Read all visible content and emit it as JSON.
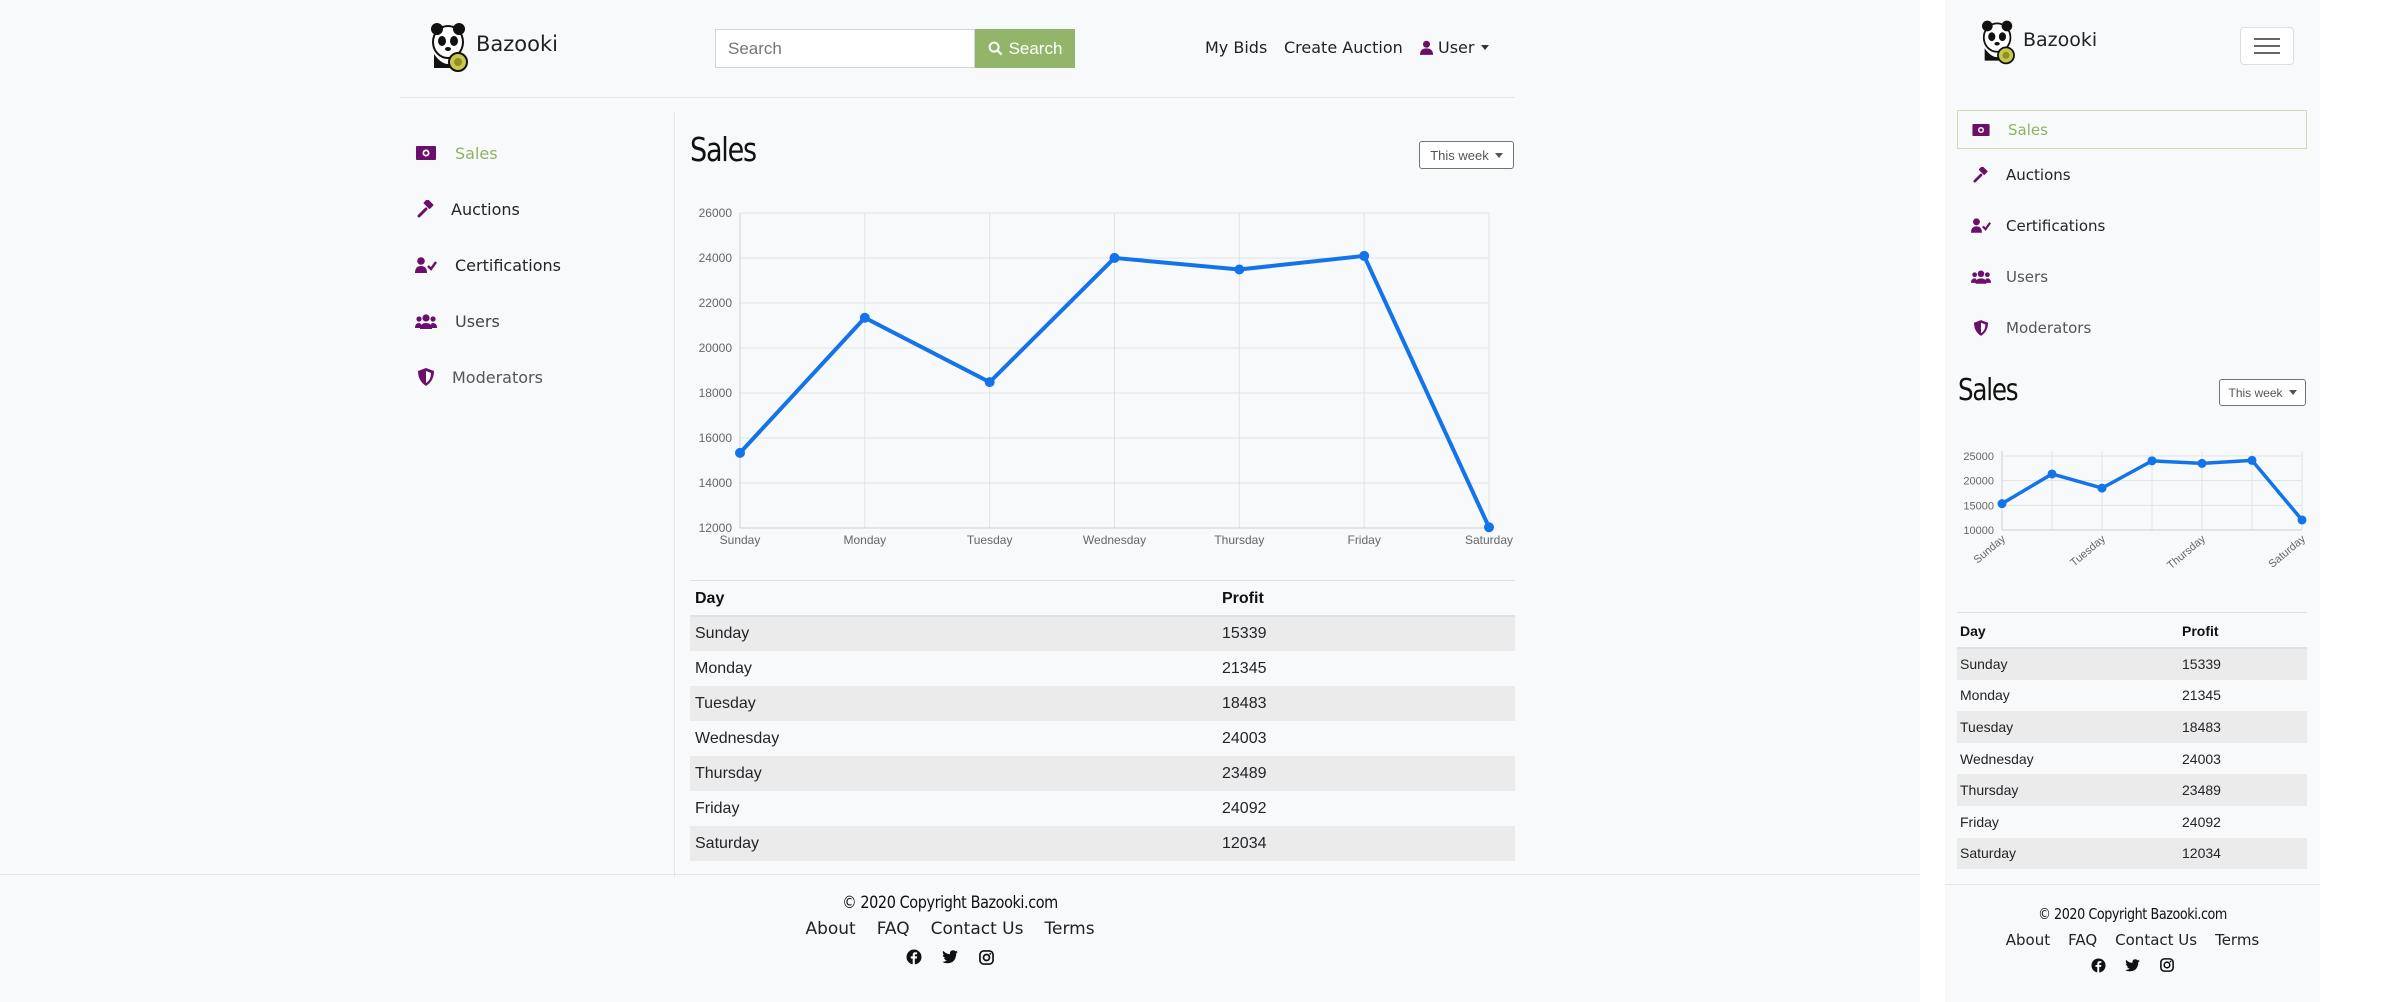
{
  "brand": {
    "name": "Bazooki"
  },
  "search": {
    "placeholder": "Search",
    "button_label": "Search"
  },
  "nav": {
    "my_bids": "My Bids",
    "create_auction": "Create Auction",
    "user": "User"
  },
  "sidebar": {
    "items": [
      {
        "label": "Sales",
        "icon": "money-bill-icon",
        "active": true
      },
      {
        "label": "Auctions",
        "icon": "gavel-icon",
        "active": false
      },
      {
        "label": "Certifications",
        "icon": "user-check-icon",
        "active": false
      },
      {
        "label": "Users",
        "icon": "users-icon",
        "active": false
      },
      {
        "label": "Moderators",
        "icon": "shield-icon",
        "active": false
      }
    ]
  },
  "main": {
    "title": "Sales",
    "period": "This week"
  },
  "colors": {
    "accent": "#93b56a",
    "icon": "#6b0f6b",
    "line": "#1273eb",
    "stripe": "#ebebeb"
  },
  "chart_data": [
    {
      "type": "line",
      "categories": [
        "Sunday",
        "Monday",
        "Tuesday",
        "Wednesday",
        "Thursday",
        "Friday",
        "Saturday"
      ],
      "series": [
        {
          "values": [
            15339,
            21345,
            18483,
            24003,
            23489,
            24092,
            12034
          ]
        }
      ],
      "yticks": [
        12000,
        14000,
        16000,
        18000,
        20000,
        22000,
        24000,
        26000
      ],
      "ylim": [
        12000,
        26000
      ],
      "grid": true
    },
    {
      "type": "line",
      "categories": [
        "Sunday",
        "Monday",
        "Tuesday",
        "Wednesday",
        "Thursday",
        "Friday",
        "Saturday"
      ],
      "xtick_labels": [
        "Sunday",
        "Tuesday",
        "Thursday",
        "Saturday"
      ],
      "series": [
        {
          "values": [
            15339,
            21345,
            18483,
            24003,
            23489,
            24092,
            12034
          ]
        }
      ],
      "yticks": [
        10000,
        15000,
        20000,
        25000
      ],
      "ylim": [
        10000,
        26000
      ],
      "grid": true
    }
  ],
  "table": {
    "headers": [
      "Day",
      "Profit"
    ],
    "rows": [
      [
        "Sunday",
        "15339"
      ],
      [
        "Monday",
        "21345"
      ],
      [
        "Tuesday",
        "18483"
      ],
      [
        "Wednesday",
        "24003"
      ],
      [
        "Thursday",
        "23489"
      ],
      [
        "Friday",
        "24092"
      ],
      [
        "Saturday",
        "12034"
      ]
    ]
  },
  "footer": {
    "copyright": "© 2020 Copyright Bazooki.com",
    "links": [
      "About",
      "FAQ",
      "Contact Us",
      "Terms"
    ],
    "social": [
      "facebook-icon",
      "twitter-icon",
      "instagram-icon"
    ]
  }
}
